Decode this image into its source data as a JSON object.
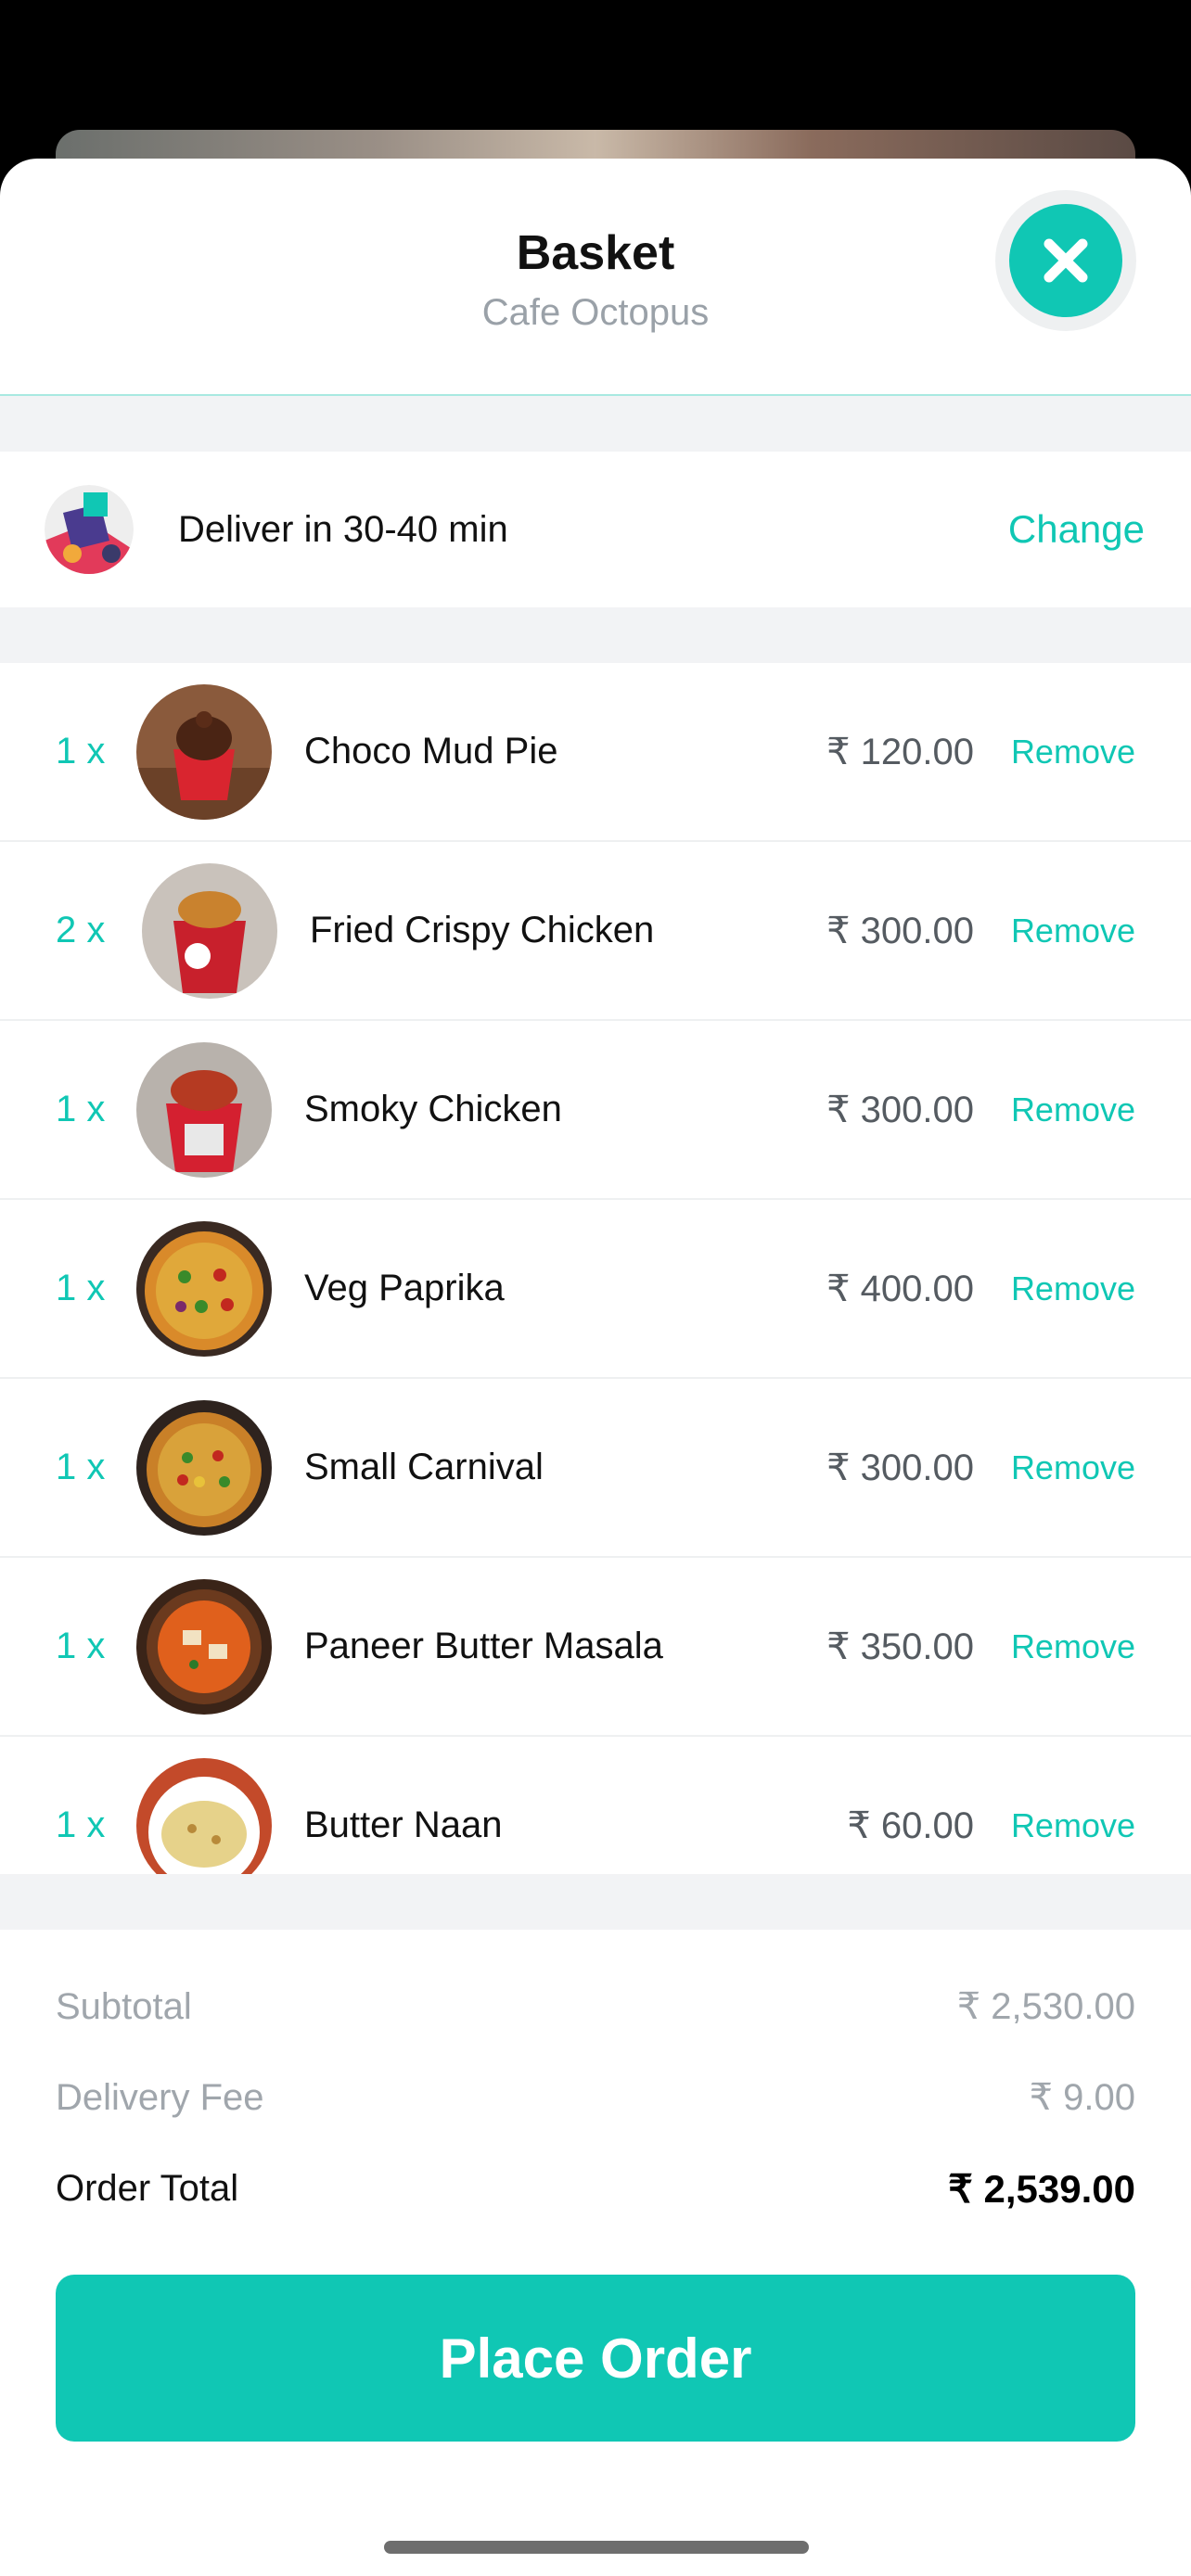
{
  "header": {
    "title": "Basket",
    "subtitle": "Cafe Octopus",
    "close_icon": "close-icon"
  },
  "delivery": {
    "text": "Deliver in 30-40 min",
    "change_label": "Change",
    "icon": "delivery-rider-icon"
  },
  "items": [
    {
      "qty": "1 x",
      "name": "Choco Mud Pie",
      "price": "₹ 120.00",
      "remove": "Remove",
      "image": "dessert-cup"
    },
    {
      "qty": "2 x",
      "name": "Fried Crispy Chicken",
      "price": "₹ 300.00",
      "remove": "Remove",
      "image": "chicken-bucket"
    },
    {
      "qty": "1 x",
      "name": "Smoky Chicken",
      "price": "₹ 300.00",
      "remove": "Remove",
      "image": "smoky-bucket"
    },
    {
      "qty": "1 x",
      "name": "Veg Paprika",
      "price": "₹ 400.00",
      "remove": "Remove",
      "image": "pizza"
    },
    {
      "qty": "1 x",
      "name": "Small Carnival",
      "price": "₹ 300.00",
      "remove": "Remove",
      "image": "pizza"
    },
    {
      "qty": "1 x",
      "name": "Paneer Butter Masala",
      "price": "₹ 350.00",
      "remove": "Remove",
      "image": "curry-bowl"
    },
    {
      "qty": "1 x",
      "name": "Butter Naan",
      "price": "₹ 60.00",
      "remove": "Remove",
      "image": "naan-plate"
    }
  ],
  "summary": {
    "subtotal_label": "Subtotal",
    "subtotal_value": "₹ 2,530.00",
    "delivery_label": "Delivery Fee",
    "delivery_value": "₹ 9.00",
    "total_label": "Order Total",
    "total_value": "₹ 2,539.00"
  },
  "cta": {
    "label": "Place Order"
  },
  "colors": {
    "accent": "#10c7b4",
    "muted": "#a0a6ac",
    "divider": "#f2f3f5"
  }
}
